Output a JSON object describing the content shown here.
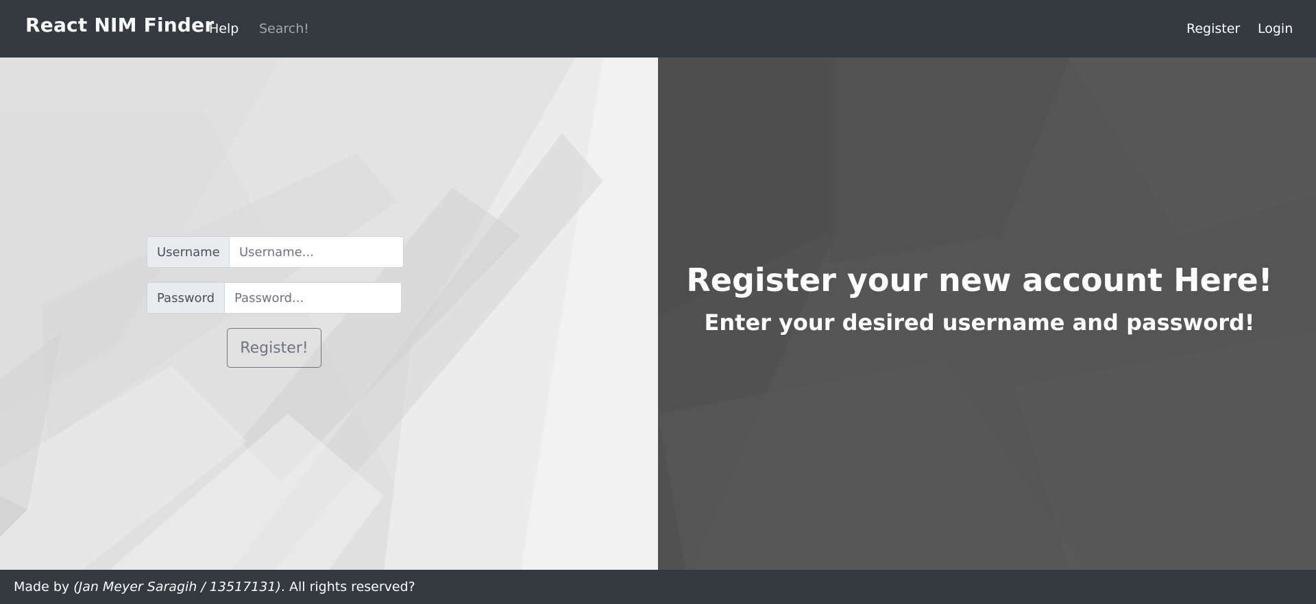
{
  "navbar": {
    "brand": "React NIM Finder",
    "links": {
      "help": "Help",
      "search": "Search!",
      "register": "Register",
      "login": "Login"
    },
    "background": "#343a40"
  },
  "form": {
    "username_label": "Username",
    "username_placeholder": "Username...",
    "username_value": "",
    "password_label": "Password",
    "password_placeholder": "Password...",
    "password_value": "",
    "submit_label": "Register!"
  },
  "hero": {
    "title": "Register your new account Here!",
    "subtitle": "Enter your desired username and password!"
  },
  "footer": {
    "prefix": "Made by ",
    "author": "(Jan Meyer Saragih / 13517131)",
    "suffix": ". All rights reserved?"
  },
  "colors": {
    "nav_bg": "#343a40",
    "left_panel_bg": "#e6e6e6",
    "right_panel_bg": "#545454",
    "button_outline": "#6c757d"
  }
}
